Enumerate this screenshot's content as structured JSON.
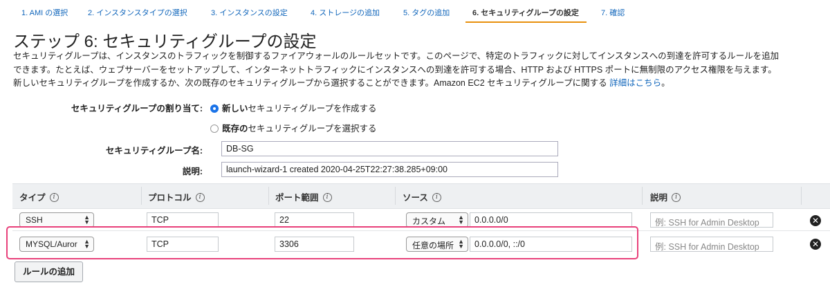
{
  "tabs": [
    {
      "label": "1. AMI の選択"
    },
    {
      "label": "2. インスタンスタイプの選択"
    },
    {
      "label": "3. インスタンスの設定"
    },
    {
      "label": "4. ストレージの追加"
    },
    {
      "label": "5. タグの追加"
    },
    {
      "label": "6. セキュリティグループの設定",
      "active": true
    },
    {
      "label": "7. 確認"
    }
  ],
  "page_title": "ステップ 6: セキュリティグループの設定",
  "description": {
    "line1": "セキュリティグループは、インスタンスのトラフィックを制御するファイアウォールのルールセットです。このページで、特定のトラフィックに対してインスタンスへの到達を許可するルールを追加",
    "line2": "できます。たとえば、ウェブサーバーをセットアップして、インターネットトラフィックにインスタンスへの到達を許可する場合、HTTP および HTTPS ポートに無制限のアクセス権限を与えます。",
    "line3": "新しいセキュリティグループを作成するか、次の既存のセキュリティグループから選択することができます。Amazon EC2 セキュリティグループに関する",
    "link": "詳細はこちら",
    "suffix": "。"
  },
  "assign": {
    "label": "セキュリティグループの割り当て:",
    "option_new_bold": "新しい",
    "option_new_rest": "セキュリティグループを作成する",
    "option_existing_bold": "既存の",
    "option_existing_rest": "セキュリティグループを選択する",
    "selected": "new"
  },
  "group_name": {
    "label": "セキュリティグループ名:",
    "value": "DB-SG"
  },
  "group_desc": {
    "label": "説明:",
    "value": "launch-wizard-1 created 2020-04-25T22:27:38.285+09:00"
  },
  "table": {
    "headers": {
      "type": "タイプ",
      "protocol": "プロトコル",
      "port": "ポート範囲",
      "source": "ソース",
      "description": "説明"
    },
    "info_glyph": "i",
    "rows": [
      {
        "type": "SSH",
        "protocol": "TCP",
        "port": "22",
        "source_select": "カスタム",
        "source_value": "0.0.0.0/0",
        "desc_placeholder": "例: SSH for Admin Desktop"
      },
      {
        "type": "MYSQL/Auror",
        "protocol": "TCP",
        "port": "3306",
        "source_select": "任意の場所",
        "source_value": "0.0.0.0/0, ::/0",
        "desc_placeholder": "例: SSH for Admin Desktop"
      }
    ],
    "remove_glyph": "✕"
  },
  "add_rule_button": "ルールの追加",
  "colors": {
    "link": "#1166bb",
    "active_tab_underline": "#e8900c",
    "highlight": "#e8407a",
    "radio_selected": "#1a73e8"
  }
}
